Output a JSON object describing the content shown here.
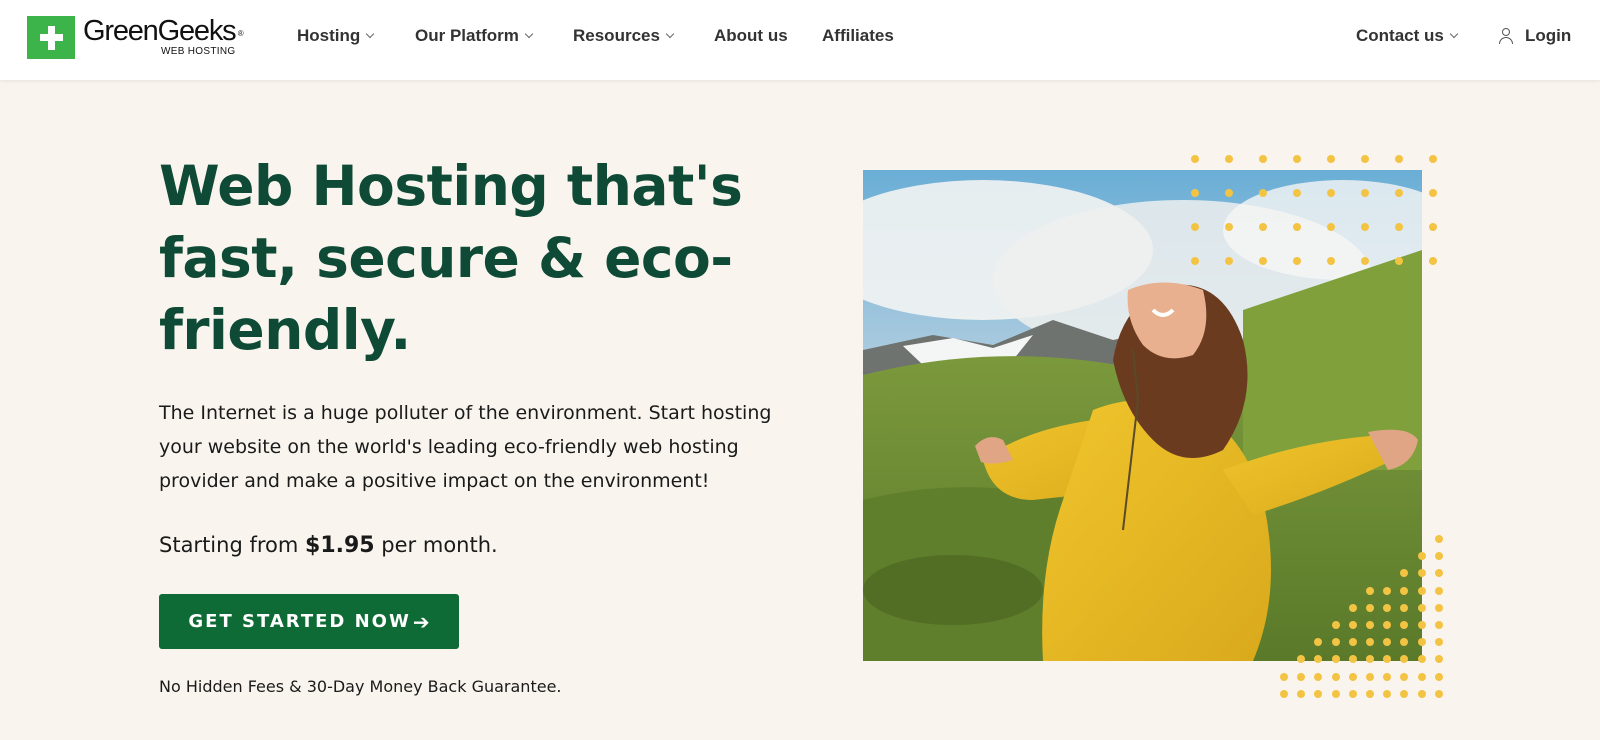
{
  "header": {
    "logo": {
      "name": "GreenGeeks",
      "registered": "®",
      "sub": "WEB HOSTING"
    },
    "nav": [
      {
        "label": "Hosting",
        "has_dropdown": true
      },
      {
        "label": "Our Platform",
        "has_dropdown": true
      },
      {
        "label": "Resources",
        "has_dropdown": true
      },
      {
        "label": "About us",
        "has_dropdown": false
      },
      {
        "label": "Affiliates",
        "has_dropdown": false
      }
    ],
    "contact": {
      "label": "Contact us",
      "has_dropdown": true
    },
    "login": {
      "label": "Login",
      "icon": "user-icon"
    }
  },
  "hero": {
    "title": "Web Hosting that's fast, secure & eco-friendly.",
    "description": "The Internet is a huge polluter of the environment. Start hosting your website on the world's leading eco-friendly web hosting provider and make a positive impact on the environment!",
    "price": {
      "prefix": "Starting from",
      "amount": "$1.95",
      "suffix": "per month."
    },
    "cta": {
      "label": "GET STARTED NOW",
      "icon": "arrow-right-icon"
    },
    "guarantee": "No Hidden Fees & 30-Day Money Back Guarantee."
  },
  "colors": {
    "brand_green": "#3cb44a",
    "headline_green": "#0f4a37",
    "cta_green": "#0f6b35",
    "dot_yellow": "#f3c443",
    "page_bg": "#f9f5ee"
  }
}
